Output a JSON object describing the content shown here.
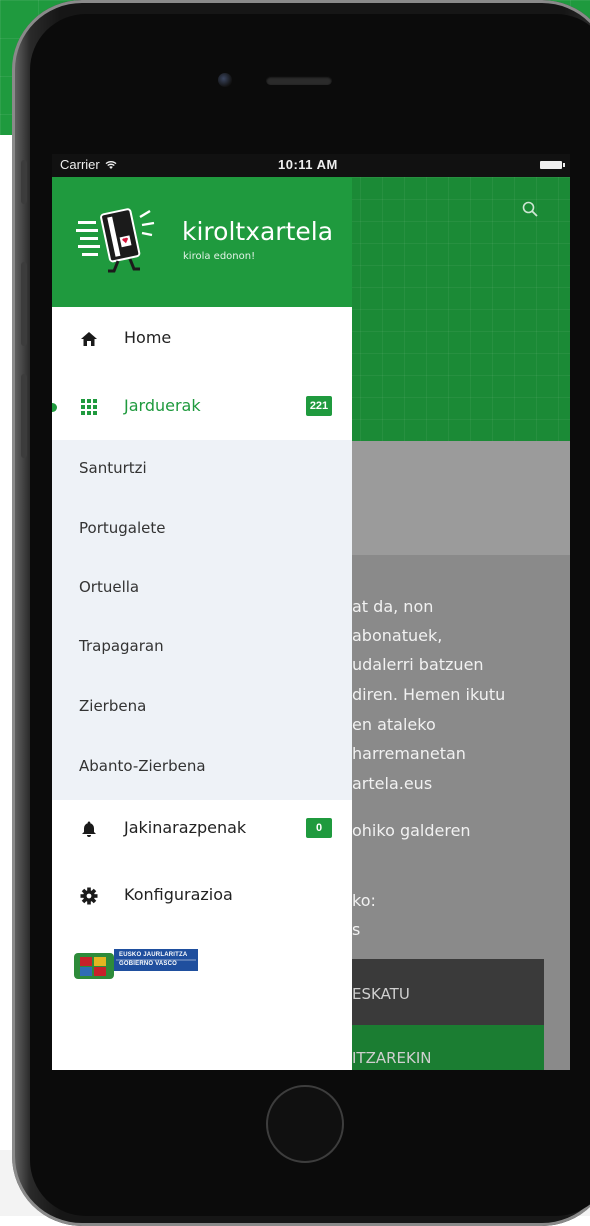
{
  "status_bar": {
    "carrier": "Carrier",
    "time": "10:11 AM"
  },
  "drawer": {
    "app_title": "kiroltxartela",
    "app_subtitle": "kirola edonon!",
    "menu": [
      {
        "label": "Home",
        "icon": "home-icon"
      },
      {
        "label": "Jarduerak",
        "icon": "grid-icon",
        "badge": "221",
        "active": true
      },
      {
        "label": "Jakinarazpenak",
        "icon": "bell-icon",
        "badge": "0"
      },
      {
        "label": "Konfigurazioa",
        "icon": "gear-icon"
      }
    ],
    "submenu": [
      "Santurtzi",
      "Portugalete",
      "Ortuella",
      "Trapagaran",
      "Zierbena",
      "Abanto-Zierbena"
    ],
    "gov_logo": {
      "line1": "EUSKO JAURLARITZA",
      "line2": "GOBIERNO VASCO"
    }
  },
  "background": {
    "lines": [
      "at da, non",
      "abonatuek,",
      "udalerri batzuen",
      "diren. Hemen ikutu",
      "en ataleko",
      "harremanetan",
      "artela.eus",
      "ohiko galderen",
      "ko:",
      "s"
    ],
    "button_dark_label": "ESKATU",
    "button_green_label": "ITZAREKIN"
  },
  "colors": {
    "brand_green": "#1f9a3e",
    "submenu_bg": "#eef2f7"
  }
}
